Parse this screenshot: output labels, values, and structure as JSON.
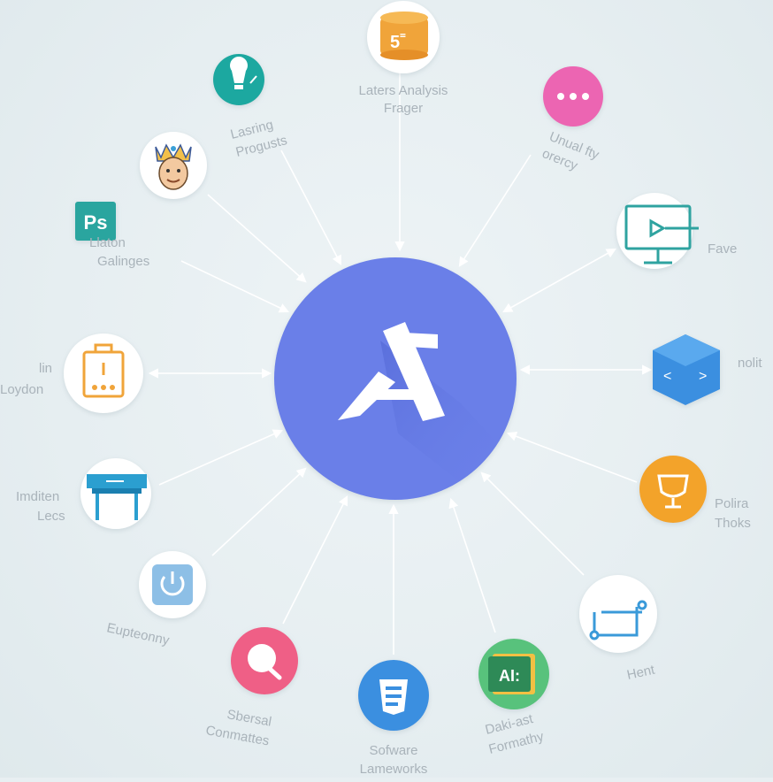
{
  "center": {
    "name": "Central logo mark",
    "color": "#6a7fe8"
  },
  "nodes": [
    {
      "id": "top",
      "lines": [
        "Laters Analysis",
        "Frager"
      ],
      "icon": "database-icon",
      "color": "#f0a43a"
    },
    {
      "id": "dots",
      "lines": [
        "Unual fty",
        "orercy"
      ],
      "icon": "dots-bubble-icon",
      "color": "#ec65b2"
    },
    {
      "id": "monitor",
      "lines": [
        "Fave"
      ],
      "icon": "monitor-icon",
      "color": "#2fa3a0"
    },
    {
      "id": "code",
      "lines": [
        "nolit"
      ],
      "icon": "code-icon",
      "color": "#3a8fe0"
    },
    {
      "id": "trophy",
      "lines": [
        "Polira",
        "Thoks"
      ],
      "icon": "trophy-icon",
      "color": "#f3a32c"
    },
    {
      "id": "circuit",
      "lines": [
        "Hent"
      ],
      "icon": "circuit-icon",
      "color": "#3a9ad9"
    },
    {
      "id": "ai",
      "lines": [
        "Daki-ast",
        "Formathy"
      ],
      "icon": "ai-icon",
      "color": "#58c27c"
    },
    {
      "id": "html",
      "lines": [
        "Sofware",
        "Lameworks"
      ],
      "icon": "document-icon",
      "color": "#3a8fe0"
    },
    {
      "id": "search",
      "lines": [
        "Sbersal",
        "Conmattes"
      ],
      "icon": "search-bubble-icon",
      "color": "#ef5f86"
    },
    {
      "id": "power",
      "lines": [
        "Eupteonny"
      ],
      "icon": "power-icon",
      "color": "#6faee0"
    },
    {
      "id": "desk",
      "lines": [
        "Imditen",
        "Lecs"
      ],
      "icon": "desk-icon",
      "color": "#2b9fd0"
    },
    {
      "id": "bag",
      "lines": [
        "lin",
        "Loydon"
      ],
      "icon": "bag-icon",
      "color": "#f0a43a"
    },
    {
      "id": "ps",
      "lines": [
        "Llaton",
        "Galinges"
      ],
      "icon": "photoshop-icon",
      "color": "#2aa59f"
    },
    {
      "id": "king",
      "lines": [],
      "icon": "king-avatar-icon",
      "color": "#f2c04a"
    },
    {
      "id": "bulb",
      "lines": [
        "Lasring",
        "Progusts"
      ],
      "icon": "lightbulb-icon",
      "color": "#1fa8a0"
    }
  ],
  "icon_text": {
    "database": "5˭",
    "ps": "Ps",
    "ai": "AI:"
  }
}
